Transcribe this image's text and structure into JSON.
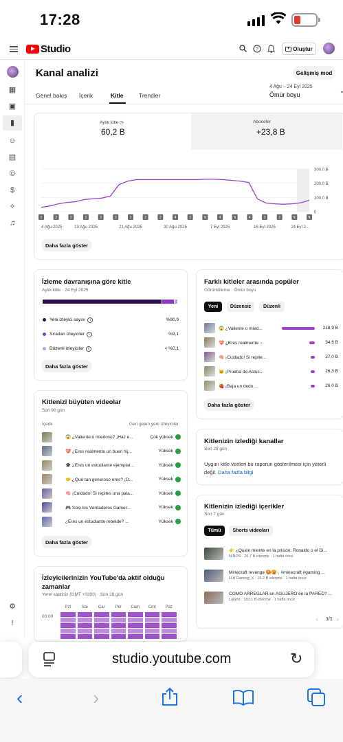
{
  "status": {
    "time": "17:28"
  },
  "header": {
    "logo_text": "Studio",
    "create_label": "Oluştur"
  },
  "page": {
    "title": "Kanal analizi",
    "advanced_mode": "Gelişmiş mod",
    "tabs": [
      "Genel bakış",
      "İçerik",
      "Kitle",
      "Trendler"
    ],
    "date_range": "4 Ağu – 24 Eyl 2025",
    "date_period": "Ömür boyu"
  },
  "chart_card": {
    "metric1_label": "Aylık kitle",
    "metric1_value": "60,2 B",
    "metric2_label": "Aboneler",
    "metric2_value": "+23,8 B",
    "more_label": "Daha fazla göster",
    "markers": [
      "2",
      "2",
      "2",
      "2",
      "2",
      "2",
      "2",
      "2",
      "2",
      "4",
      "2",
      "",
      "4",
      "",
      "4",
      "2",
      "2",
      "",
      ""
    ]
  },
  "chart_data": {
    "type": "line",
    "x_tick_labels": [
      "4 Ağu 2025",
      "13 Ağu 2025",
      "21 Ağu 2025",
      "30 Ağu 2025",
      "7 Eyl 2025",
      "16 Eyl 2025",
      "24 Eyl 2..."
    ],
    "y_tick_labels": [
      "300,0 B",
      "200,0 B",
      "100,0 B",
      "0"
    ],
    "ylim": [
      0,
      300
    ],
    "values": [
      30,
      40,
      55,
      65,
      70,
      85,
      90,
      95,
      110,
      190,
      215,
      225,
      225,
      225,
      225,
      225,
      225,
      225,
      225,
      228,
      228,
      225,
      220,
      215,
      205,
      90,
      60,
      55,
      52,
      55,
      62,
      80
    ],
    "color": "#9c3fc9",
    "grid": true
  },
  "behavior": {
    "title": "İzleme davranışına göre kitle",
    "subtitle": "Aylık kitle · 24 Eyl 2025",
    "rows": [
      {
        "label": "Yeni izleyici sayısı",
        "value": "%90,9",
        "color": "#2a0f4a"
      },
      {
        "label": "Sıradan izleyiciler",
        "value": "%9,1",
        "color": "#8e35c8"
      },
      {
        "label": "Düzenli izleyiciler",
        "value": "< %0,1",
        "color": "#c99ae8"
      }
    ],
    "bar_fractions": [
      0.909,
      0.091,
      0.001
    ],
    "more_label": "Daha fazla göster"
  },
  "growth": {
    "title": "Kitlenizi büyüten videolar",
    "subtitle": "Son 90 gün",
    "col_content": "İçerik",
    "col_new": "Geri gelen yeni izleyiciler",
    "rows": [
      {
        "title": "😱 ¿Valiente o miedoso? ¡Haz e...",
        "level": "Çok yüksek"
      },
      {
        "title": "💝 ¿Eres realmente un buen hij...",
        "level": "Yüksek"
      },
      {
        "title": "🎓 ¿Eres un estudiante ejemplar...",
        "level": "Yüksek"
      },
      {
        "title": "🤝 ¿Qué tan generoso eres? ¡D...",
        "level": "Yüksek"
      },
      {
        "title": "🧠 ¡Cuidado! Si repites una pala...",
        "level": "Yüksek"
      },
      {
        "title": "🎮 Solo los Verdaderos Gamer...",
        "level": "Yüksek"
      },
      {
        "title": "¿Eres un estudiante rebelde? ...",
        "level": "Yüksek"
      }
    ],
    "more_label": "Daha fazla göster"
  },
  "active_time": {
    "title": "İzleyicilerinizin YouTube'da aktif olduğu zamanlar",
    "subtitle": "Yerel saatiniz (GMT +0300) · Son 28 gün",
    "days": [
      "Pzt",
      "Sal",
      "Çar",
      "Per",
      "Cum",
      "Cmt",
      "Paz"
    ],
    "hour_label": "00:00"
  },
  "popular": {
    "title": "Farklı kitleler arasında popüler",
    "subtitle": "Görüntüleme · Ömür boyu",
    "chips": [
      "Yeni",
      "Düzensiz",
      "Düzenli"
    ],
    "rows": [
      {
        "title": "😱 ¿Valiente o mied...",
        "value": "218,9 B",
        "frac": 1.0
      },
      {
        "title": "💝 ¿Eres realmente ...",
        "value": "34,6 B",
        "frac": 0.16
      },
      {
        "title": "🧠 ¡Cuidado! Si repite...",
        "value": "27,0 B",
        "frac": 0.12
      },
      {
        "title": "🐱 ¡Prueba de Astuc...",
        "value": "26,3 B",
        "frac": 0.12
      },
      {
        "title": "🍓 ¡Baja un dedo ...",
        "value": "26,0 B",
        "frac": 0.12
      }
    ],
    "more_label": "Daha fazla göster"
  },
  "channels": {
    "title": "Kitlenizin izlediği kanallar",
    "subtitle": "Son 28 gün",
    "text": "Uygun kitle verileri bu raporun gösterilmesi için yeterli değil.",
    "link": "Daha fazla bilgi"
  },
  "contents": {
    "title": "Kitlenizin izlediği içerikler",
    "subtitle": "Son 7 gün",
    "chips": [
      "Tümü",
      "Shorts videoları"
    ],
    "rows": [
      {
        "title": "👉 ¿Quién miente en la prisión. Ronaldo o el Di...",
        "meta": "NINOS · 26,7 B izlenme · 1 hafta önce"
      },
      {
        "title": "Minecraft revenge 😡😡 , #minecraft #gaming ...",
        "meta": "H.A Gaming_X · 15,2 B izlenme · 1 hafta önce"
      },
      {
        "title": "CÓMO ARREGLAR un AGUJERO en la PARED? ...",
        "meta": "Laland · 183,1 B izlenme · 1 hafta önce"
      }
    ],
    "pager": "1/1"
  },
  "browser": {
    "url": "studio.youtube.com"
  }
}
